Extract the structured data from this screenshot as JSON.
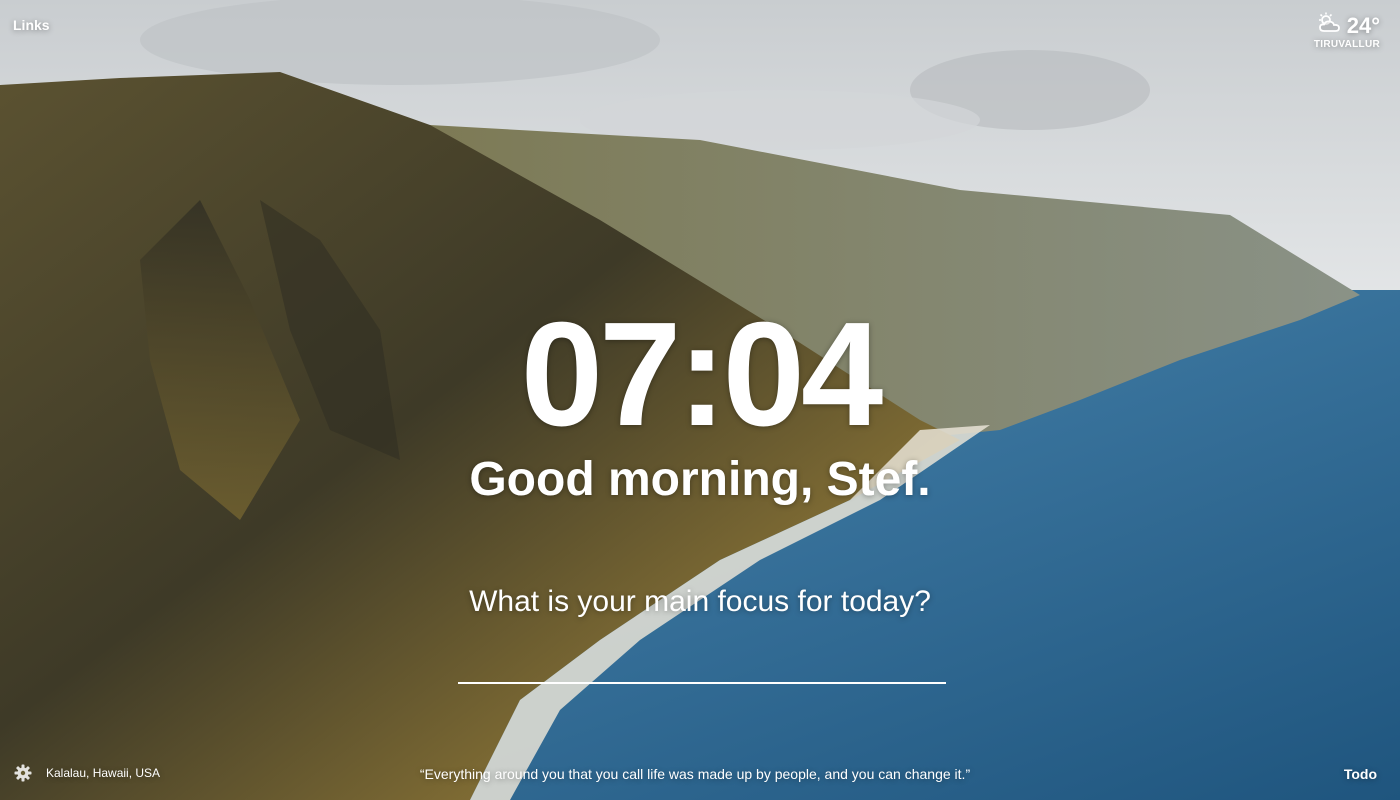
{
  "links": {
    "label": "Links"
  },
  "weather": {
    "temperature": "24°",
    "location": "TIRUVALLUR",
    "icon": "partly-cloudy-icon"
  },
  "clock": {
    "time": "07:04"
  },
  "greeting": {
    "text": "Good morning, Stef."
  },
  "focus": {
    "question": "What is your main focus for today?",
    "value": ""
  },
  "footer": {
    "photo_location": "Kalalau, Hawaii, USA",
    "quote": "“Everything around you that you call life was made up by people, and you can change it.”",
    "todo_label": "Todo",
    "settings_icon": "gear-icon"
  },
  "colors": {
    "text": "#ffffff",
    "ocean": "#2a6a94",
    "sky": "#e6e8ea",
    "cliff": "#6b6033"
  }
}
